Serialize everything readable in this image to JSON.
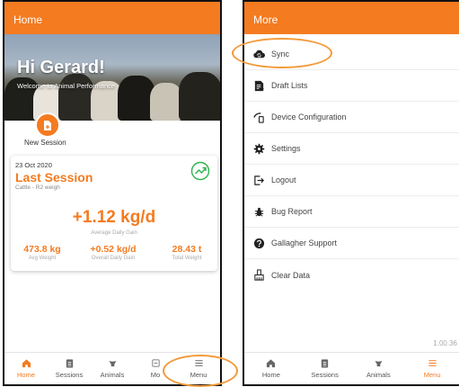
{
  "home": {
    "title": "Home",
    "greeting": "Hi Gerard!",
    "welcome": "Welcome to Animal Performance",
    "new_session_label": "New Session",
    "last_session": {
      "date": "23 Oct 2020",
      "title": "Last Session",
      "subtitle": "Cattle - R2 weigh",
      "adg_value": "+1.12 kg/d",
      "adg_caption": "Average Daily Gain",
      "stats": [
        {
          "value": "473.8 kg",
          "caption": "Avg Weight"
        },
        {
          "value": "+0.52 kg/d",
          "caption": "Overall Daily Gain"
        },
        {
          "value": "28.43 t",
          "caption": "Total Weight"
        }
      ]
    },
    "nav": [
      {
        "label": "Home",
        "icon": "home-icon",
        "active": true
      },
      {
        "label": "Sessions",
        "icon": "clipboard-icon",
        "active": false
      },
      {
        "label": "Animals",
        "icon": "cow-head-icon",
        "active": false
      },
      {
        "label": "Mo",
        "icon": "device-icon",
        "active": false
      },
      {
        "label": "Menu",
        "icon": "menu-icon",
        "active": false
      }
    ]
  },
  "more": {
    "title": "More",
    "items": [
      {
        "label": "Sync",
        "icon": "cloud-sync-icon"
      },
      {
        "label": "Draft Lists",
        "icon": "document-list-icon"
      },
      {
        "label": "Device Configuration",
        "icon": "device-config-icon"
      },
      {
        "label": "Settings",
        "icon": "gear-icon"
      },
      {
        "label": "Logout",
        "icon": "logout-icon"
      },
      {
        "label": "Bug Report",
        "icon": "bug-icon"
      },
      {
        "label": "Gallagher Support",
        "icon": "help-icon"
      },
      {
        "label": "Clear Data",
        "icon": "clear-data-icon"
      }
    ],
    "version": "1.00.36",
    "nav": [
      {
        "label": "Home",
        "icon": "home-icon",
        "active": false
      },
      {
        "label": "Sessions",
        "icon": "clipboard-icon",
        "active": false
      },
      {
        "label": "Animals",
        "icon": "cow-head-icon",
        "active": false
      },
      {
        "label": "Menu",
        "icon": "menu-icon",
        "active": true
      }
    ]
  },
  "colors": {
    "accent": "#f47b20",
    "highlight": "#f39a3a"
  }
}
